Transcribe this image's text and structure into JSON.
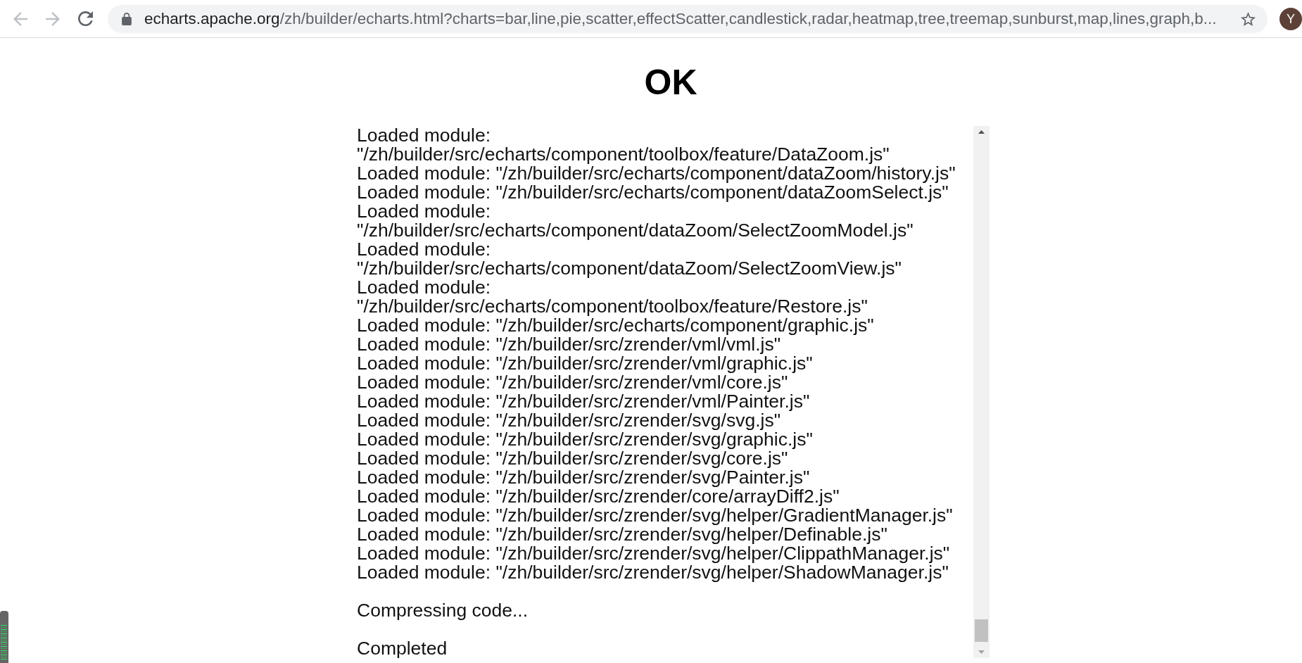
{
  "browser": {
    "nav_buttons": [
      {
        "kind": "back",
        "disabled": true
      },
      {
        "kind": "forward",
        "disabled": true
      },
      {
        "kind": "reload",
        "disabled": false
      }
    ],
    "address": {
      "host": "echarts.apache.org",
      "path": "/zh/builder/echarts.html?charts=bar,line,pie,scatter,effectScatter,candlestick,radar,heatmap,tree,treemap,sunburst,map,lines,graph,b..."
    },
    "avatar": {
      "initial": "Y"
    }
  },
  "heading": "OK",
  "log": {
    "entries": [
      {
        "kind": "module",
        "text": "Loaded module: \"/zh/builder/src/echarts/component/toolbox/feature/DataZoom.js\""
      },
      {
        "kind": "module",
        "text": "Loaded module: \"/zh/builder/src/echarts/component/dataZoom/history.js\""
      },
      {
        "kind": "module",
        "text": "Loaded module: \"/zh/builder/src/echarts/component/dataZoomSelect.js\""
      },
      {
        "kind": "module",
        "text": "Loaded module: \"/zh/builder/src/echarts/component/dataZoom/SelectZoomModel.js\""
      },
      {
        "kind": "module",
        "text": "Loaded module: \"/zh/builder/src/echarts/component/dataZoom/SelectZoomView.js\""
      },
      {
        "kind": "module",
        "text": "Loaded module: \"/zh/builder/src/echarts/component/toolbox/feature/Restore.js\""
      },
      {
        "kind": "module",
        "text": "Loaded module: \"/zh/builder/src/echarts/component/graphic.js\""
      },
      {
        "kind": "module",
        "text": "Loaded module: \"/zh/builder/src/zrender/vml/vml.js\""
      },
      {
        "kind": "module",
        "text": "Loaded module: \"/zh/builder/src/zrender/vml/graphic.js\""
      },
      {
        "kind": "module",
        "text": "Loaded module: \"/zh/builder/src/zrender/vml/core.js\""
      },
      {
        "kind": "module",
        "text": "Loaded module: \"/zh/builder/src/zrender/vml/Painter.js\""
      },
      {
        "kind": "module",
        "text": "Loaded module: \"/zh/builder/src/zrender/svg/svg.js\""
      },
      {
        "kind": "module",
        "text": "Loaded module: \"/zh/builder/src/zrender/svg/graphic.js\""
      },
      {
        "kind": "module",
        "text": "Loaded module: \"/zh/builder/src/zrender/svg/core.js\""
      },
      {
        "kind": "module",
        "text": "Loaded module: \"/zh/builder/src/zrender/svg/Painter.js\""
      },
      {
        "kind": "module",
        "text": "Loaded module: \"/zh/builder/src/zrender/core/arrayDiff2.js\""
      },
      {
        "kind": "module",
        "text": "Loaded module: \"/zh/builder/src/zrender/svg/helper/GradientManager.js\""
      },
      {
        "kind": "module",
        "text": "Loaded module: \"/zh/builder/src/zrender/svg/helper/Definable.js\""
      },
      {
        "kind": "module",
        "text": "Loaded module: \"/zh/builder/src/zrender/svg/helper/ClippathManager.js\""
      },
      {
        "kind": "module",
        "text": "Loaded module: \"/zh/builder/src/zrender/svg/helper/ShadowManager.js\""
      },
      {
        "kind": "status",
        "text": "Compressing code..."
      },
      {
        "kind": "status",
        "text": "Completed"
      }
    ]
  }
}
